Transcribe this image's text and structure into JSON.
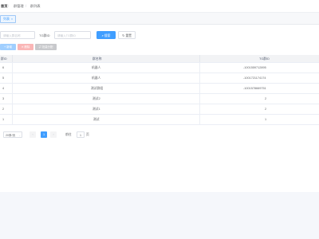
{
  "breadcrumb": {
    "home": "首页",
    "sep1": "/",
    "item1": "群管理",
    "sep2": "/",
    "item2": "群列表"
  },
  "tags": {
    "active_label": "列表",
    "close": "×"
  },
  "search": {
    "name_placeholder": "请输入群名称",
    "tg_label": "TG群ID",
    "tg_placeholder": "请输入TG群ID",
    "search_label": "搜索",
    "reset_label": "重置",
    "search_icon": "search-icon",
    "reset_icon": "refresh-icon"
  },
  "toolbar": {
    "add_label": "新增",
    "delete_label": "删除",
    "assign_label": "批量分配"
  },
  "table": {
    "headers": {
      "id": "群ID",
      "name": "群名称",
      "tgid": "TG群ID"
    },
    "rows": [
      {
        "id": "6",
        "name": "机器人",
        "tgid": "-1001559712895"
      },
      {
        "id": "5",
        "name": "机器人",
        "tgid": "-1001721174174"
      },
      {
        "id": "4",
        "name": "测试群组",
        "tgid": "-1001578669751"
      },
      {
        "id": "3",
        "name": "测试2",
        "tgid": "2"
      },
      {
        "id": "2",
        "name": "测试1",
        "tgid": "2"
      },
      {
        "id": "1",
        "name": "测试",
        "tgid": "1"
      }
    ]
  },
  "pagination": {
    "page_size": "20条/页",
    "page": "1",
    "goto_label": "前往",
    "goto_value": "1",
    "page_unit": "页"
  }
}
